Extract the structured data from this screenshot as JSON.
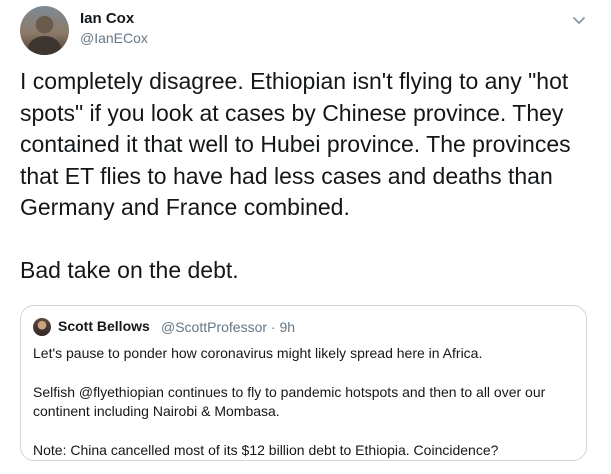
{
  "author": {
    "name": "Ian Cox",
    "handle": "@IanECox"
  },
  "icons": {
    "menu": "chevron-down-icon"
  },
  "tweet": {
    "paragraph1": "I completely disagree. Ethiopian isn't flying to any \"hot spots\" if you look at cases by Chinese province. They contained it that well to Hubei province. The provinces that ET flies to have had less cases and deaths than Germany and France combined.",
    "paragraph2": "Bad take on the debt."
  },
  "quote": {
    "name": "Scott Bellows",
    "handle_time": "@ScottProfessor · 9h",
    "line1": "Let's pause to ponder how coronavirus might likely spread here in Africa.",
    "line2": "Selfish @flyethiopian continues to fly to pandemic hotspots and then to all over our continent including Nairobi & Mombasa.",
    "line3": "Note: China cancelled most of its $12 billion debt to Ethiopia. Coincidence?"
  },
  "colors": {
    "text_primary": "#14171a",
    "text_secondary": "#657786",
    "border": "#ccd6dd"
  }
}
